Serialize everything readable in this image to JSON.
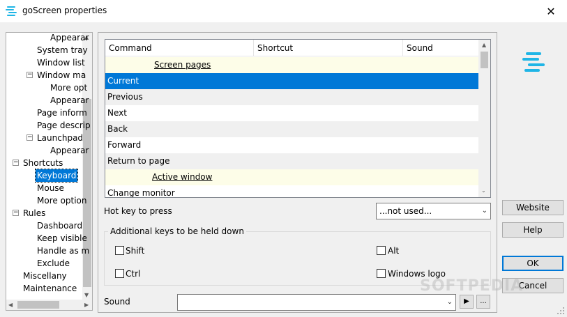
{
  "window": {
    "title": "goScreen properties"
  },
  "tree": {
    "items": [
      {
        "label": "Appearar",
        "level": 3,
        "expander": ""
      },
      {
        "label": "System tray",
        "level": 2,
        "expander": ""
      },
      {
        "label": "Window list",
        "level": 2,
        "expander": ""
      },
      {
        "label": "Window ma",
        "level": 2,
        "expander": "−"
      },
      {
        "label": "More opt",
        "level": 3,
        "expander": ""
      },
      {
        "label": "Appearar",
        "level": 3,
        "expander": ""
      },
      {
        "label": "Page inform",
        "level": 2,
        "expander": ""
      },
      {
        "label": "Page descrip",
        "level": 2,
        "expander": ""
      },
      {
        "label": "Launchpad",
        "level": 2,
        "expander": "−"
      },
      {
        "label": "Appearar",
        "level": 3,
        "expander": ""
      },
      {
        "label": "Shortcuts",
        "level": 1,
        "expander": "−"
      },
      {
        "label": "Keyboard",
        "level": 2,
        "expander": "",
        "selected": true
      },
      {
        "label": "Mouse",
        "level": 2,
        "expander": ""
      },
      {
        "label": "More option",
        "level": 2,
        "expander": ""
      },
      {
        "label": "Rules",
        "level": 1,
        "expander": "−"
      },
      {
        "label": "Dashboard",
        "level": 2,
        "expander": ""
      },
      {
        "label": "Keep visible",
        "level": 2,
        "expander": ""
      },
      {
        "label": "Handle as m",
        "level": 2,
        "expander": ""
      },
      {
        "label": "Exclude",
        "level": 2,
        "expander": ""
      },
      {
        "label": "Miscellany",
        "level": 1,
        "expander": ""
      },
      {
        "label": "Maintenance",
        "level": 1,
        "expander": ""
      }
    ]
  },
  "commands": {
    "columns": [
      "Command",
      "Shortcut",
      "Sound"
    ],
    "rows": [
      {
        "label": "Screen pages",
        "kind": "group"
      },
      {
        "label": "Current",
        "kind": "selected"
      },
      {
        "label": "Previous",
        "kind": "even"
      },
      {
        "label": "Next",
        "kind": "odd"
      },
      {
        "label": "Back",
        "kind": "even"
      },
      {
        "label": "Forward",
        "kind": "odd"
      },
      {
        "label": "Return to page",
        "kind": "even"
      },
      {
        "label": "Active window",
        "kind": "group"
      },
      {
        "label": "Change monitor",
        "kind": "odd"
      }
    ]
  },
  "hotkey": {
    "label": "Hot key to press",
    "value": "...not used..."
  },
  "additional": {
    "title": "Additional keys to be held down",
    "shift": "Shift",
    "ctrl": "Ctrl",
    "alt": "Alt",
    "windows": "Windows logo"
  },
  "sound": {
    "label": "Sound",
    "value": "",
    "browse": "..."
  },
  "buttons": {
    "website": "Website",
    "help": "Help",
    "ok": "OK",
    "cancel": "Cancel"
  },
  "watermark": "SOFTPEDIA",
  "colors": {
    "accent": "#0078d7",
    "group_row": "#fdfde8",
    "logo": "#1fb5e6"
  }
}
